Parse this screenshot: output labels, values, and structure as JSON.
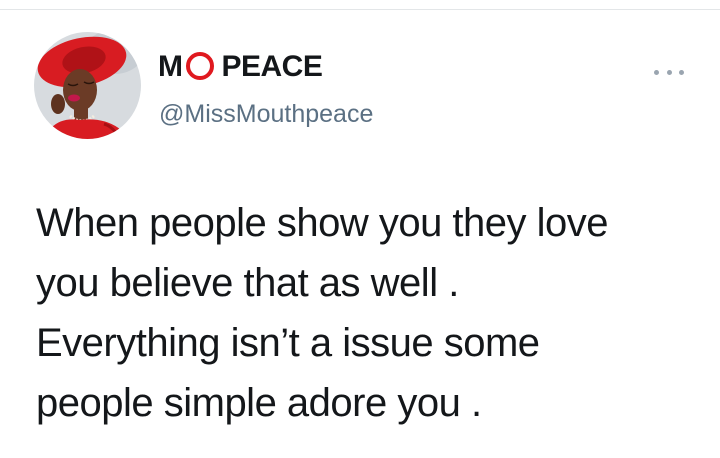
{
  "tweet": {
    "author": {
      "name_prefix": "M",
      "name_suffix": "PEACE",
      "handle": "@MissMouthpeace"
    },
    "text_lines": [
      "When people show you they love",
      "you believe that as well .",
      "Everything isn’t a issue some",
      "people simple adore you ."
    ]
  },
  "colors": {
    "brand_red": "#e0191f",
    "text": "#14171a",
    "secondary_text": "#5b7083"
  },
  "icons": {
    "more": "more-horizontal-icon"
  }
}
